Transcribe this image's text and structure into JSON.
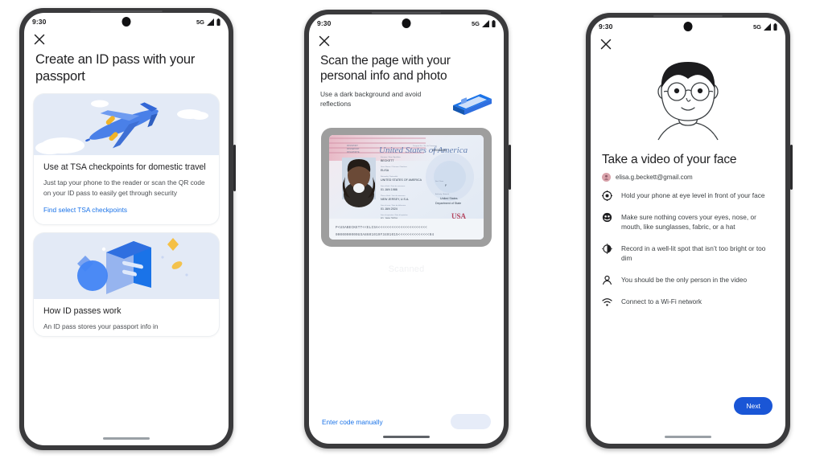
{
  "meta": {
    "background": "#ffffff",
    "accent_blue": "#1a73e8",
    "button_blue": "#1a56d6",
    "card_art_bg": "#e3eaf6"
  },
  "status_bar": {
    "time": "9:30",
    "network": "5G",
    "signal_icon": "signal-bars-icon",
    "battery_icon": "battery-icon"
  },
  "phone1": {
    "close_icon": "close-icon",
    "headline": "Create an ID pass with your passport",
    "cards": [
      {
        "art_icon": "airplane-illustration",
        "title": "Use at TSA checkpoints for domestic travel",
        "body": "Just tap your phone to the reader or scan the QR code on your ID pass to easily get through security",
        "link": "Find select TSA checkpoints"
      },
      {
        "art_icon": "id-card-sparkle-illustration",
        "title": "How ID passes work",
        "body": "An ID pass stores your passport info in",
        "link": ""
      }
    ],
    "touch_indicator": {
      "name": "touch-ripple",
      "color": "#4285f4"
    }
  },
  "phone2": {
    "close_icon": "close-icon",
    "headline": "Scan the page with your personal info and photo",
    "subline": "Use a dark background and avoid reflections",
    "mini_art_icon": "passport-card-illustration",
    "scan_frame": {
      "name": "passport-scan-viewfinder",
      "document_title": "UNITED STATES OF AMERICA",
      "fields": {
        "surname": "BECKETT",
        "given_name": "ELISA",
        "nationality": "UNITED STATES OF AMERICA",
        "date_of_birth": "01 JAN 1986",
        "place_of_birth": "NEW JERSEY, U.S.A.",
        "date_of_issue": "01 JAN 2024",
        "date_of_expiration": "01 JAN 2034",
        "sex": "F",
        "authority": "United States Department of State",
        "endorsements": "SEE PAGE 27",
        "passport_number": "000000000",
        "country_mark": "USA"
      }
    },
    "scanned_label": "Scanned",
    "manual_link": "Enter code manually",
    "ghost_button": "continue-button"
  },
  "phone3": {
    "close_icon": "close-icon",
    "face_illustration": "face-illustration",
    "headline": "Take a video of your face",
    "account": {
      "avatar_icon": "account-avatar",
      "email": "elisa.g.beckett@gmail.com"
    },
    "tips": [
      {
        "icon": "target-icon",
        "text": "Hold your phone at eye level in front of your face"
      },
      {
        "icon": "face-mask-icon",
        "text": "Make sure nothing covers your eyes, nose, or mouth, like sunglasses, fabric, or a hat"
      },
      {
        "icon": "brightness-icon",
        "text": "Record in a well-lit spot that isn’t too bright or too dim"
      },
      {
        "icon": "person-icon",
        "text": "You should be the only person in the video"
      },
      {
        "icon": "wifi-icon",
        "text": "Connect to a Wi-Fi network"
      }
    ],
    "next_button": "Next"
  }
}
